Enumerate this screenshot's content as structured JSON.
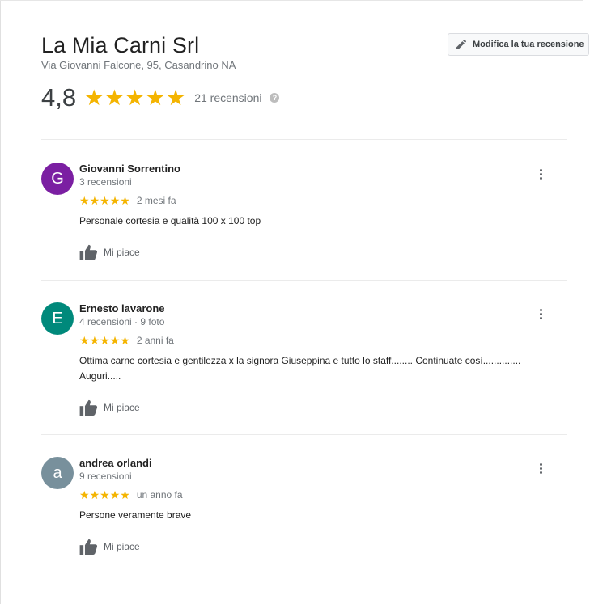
{
  "business": {
    "name": "La Mia Carni Srl",
    "address": "Via Giovanni Falcone, 95, Casandrino NA"
  },
  "edit_button": {
    "label": "Modifica la tua recensione",
    "icon": "pencil-icon"
  },
  "summary": {
    "rating": "4,8",
    "stars": 5,
    "reviews_count": "21 recensioni",
    "help_icon": "question-icon"
  },
  "reviews": [
    {
      "initial": "G",
      "avatar_color": "#7b1fa2",
      "author": "Giovanni Sorrentino",
      "meta": "3 recensioni",
      "stars": 5,
      "date": "2 mesi fa",
      "text": "Personale cortesia e qualità 100 x 100 top",
      "like_label": "Mi piace"
    },
    {
      "initial": "E",
      "avatar_color": "#00897b",
      "author": "Ernesto lavarone",
      "meta": "4 recensioni · 9 foto",
      "stars": 5,
      "date": "2 anni fa",
      "text": "Ottima carne cortesia e gentilezza x la signora Giuseppina e tutto lo staff........ Continuate così.............. Auguri.....",
      "like_label": "Mi piace"
    },
    {
      "initial": "a",
      "avatar_color": "#78909c",
      "author": "andrea orlandi",
      "meta": "9 recensioni",
      "stars": 5,
      "date": "un anno fa",
      "text": "Persone veramente brave",
      "like_label": "Mi piace"
    }
  ]
}
